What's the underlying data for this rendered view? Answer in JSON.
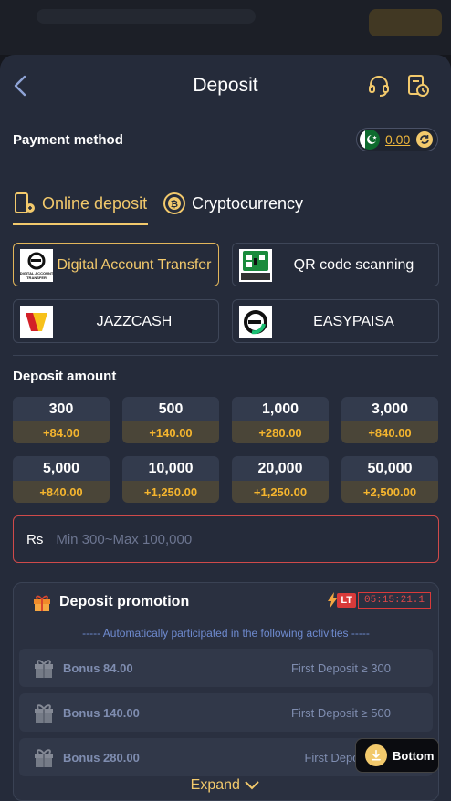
{
  "header": {
    "title": "Deposit"
  },
  "payment": {
    "label": "Payment method",
    "balance": "0.00"
  },
  "tabs": [
    {
      "label": "Online deposit",
      "active": true,
      "icon": "phone-deposit-icon"
    },
    {
      "label": "Cryptocurrency",
      "active": false,
      "icon": "bitcoin-icon"
    }
  ],
  "methods": [
    {
      "label": "Digital Account Transfer",
      "logo_text": "DIGITAL ACCOUNT TRANSFER",
      "active": true
    },
    {
      "label": "QR code scanning",
      "logo_text": "QR",
      "active": false
    },
    {
      "label": "JAZZCASH",
      "active": false
    },
    {
      "label": "EASYPAISA",
      "active": false
    }
  ],
  "deposit": {
    "label": "Deposit amount",
    "amounts": [
      {
        "value": "300",
        "bonus": "+84.00"
      },
      {
        "value": "500",
        "bonus": "+140.00"
      },
      {
        "value": "1,000",
        "bonus": "+280.00"
      },
      {
        "value": "3,000",
        "bonus": "+840.00"
      },
      {
        "value": "5,000",
        "bonus": "+840.00"
      },
      {
        "value": "10,000",
        "bonus": "+1,250.00"
      },
      {
        "value": "20,000",
        "bonus": "+1,250.00"
      },
      {
        "value": "50,000",
        "bonus": "+2,500.00"
      }
    ],
    "currency": "Rs",
    "placeholder": "Min 300~Max 100,000"
  },
  "promotion": {
    "title": "Deposit promotion",
    "badge": "LT",
    "timer": "05:15:21.1",
    "subtitle": "----- Automatically participated in the following activities -----",
    "rows": [
      {
        "name": "Bonus 84.00",
        "condition": "First Deposit ≥ 300"
      },
      {
        "name": "Bonus 140.00",
        "condition": "First Deposit ≥ 500"
      },
      {
        "name": "Bonus 280.00",
        "condition": "First Deposit ≥ 1"
      }
    ]
  },
  "bottom_button": "Bottom",
  "expand": "Expand",
  "colors": {
    "accent": "#f2c96c",
    "bonus": "#f5b52e",
    "sheet": "#252b3a",
    "error": "#d04a4a"
  }
}
